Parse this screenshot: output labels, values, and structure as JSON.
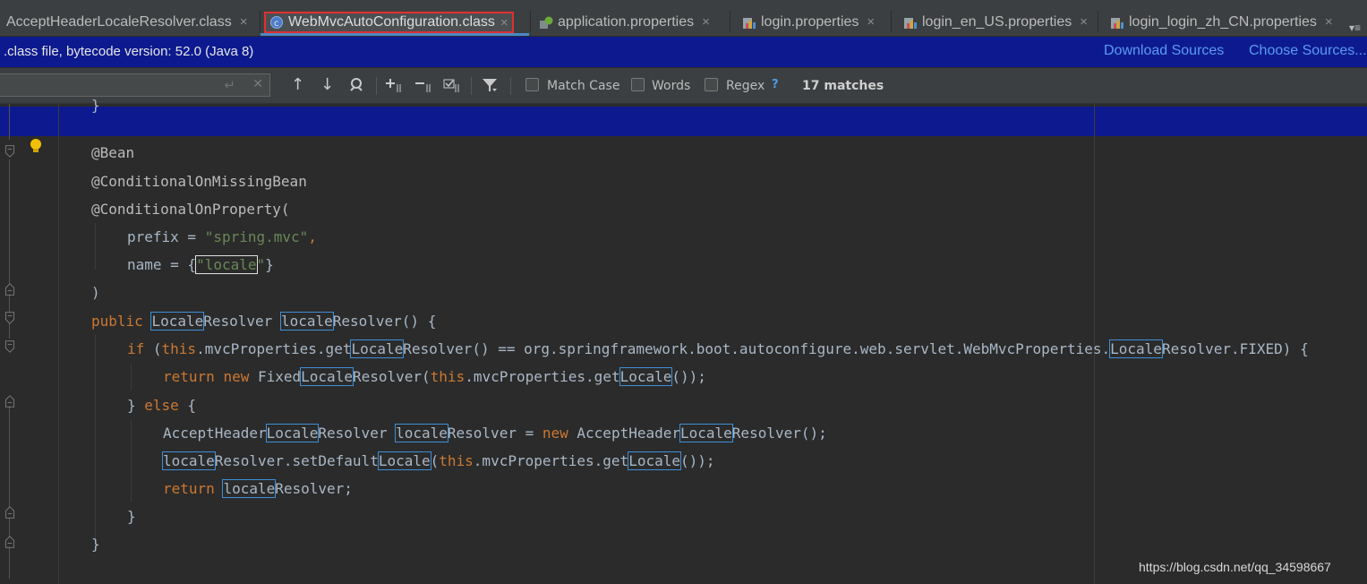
{
  "tabs": [
    {
      "label": "AcceptHeaderLocaleResolver.class",
      "icon": "class-file-icon"
    },
    {
      "label": "WebMvcAutoConfiguration.class",
      "icon": "class-file-icon",
      "active": true
    },
    {
      "label": "application.properties",
      "icon": "spring-properties-icon"
    },
    {
      "label": "login.properties",
      "icon": "properties-file-icon"
    },
    {
      "label": "login_en_US.properties",
      "icon": "properties-file-icon"
    },
    {
      "label": "login_login_zh_CN.properties",
      "icon": "properties-file-icon"
    }
  ],
  "tab_close_glyph": "×",
  "tab_overflow_glyph": "▾≡",
  "banner": {
    "message": ".class file, bytecode version: 52.0 (Java 8)",
    "download_sources": "Download Sources",
    "choose_sources": "Choose Sources..."
  },
  "findbar": {
    "search_value": "",
    "options": {
      "match_case": "Match Case",
      "words": "Words",
      "regex": "Regex"
    },
    "help": "?",
    "matches": "17 matches"
  },
  "code": {
    "l_bean": "@Bean",
    "l_missing": "@ConditionalOnMissingBean",
    "l_property": "@ConditionalOnProperty(",
    "prefix_a": "prefix = ",
    "prefix_str": "\"spring.mvc\"",
    "prefix_c": ",",
    "name_a": "name = {",
    "name_q1": "\"",
    "name_hit": "locale",
    "name_q2": "\"",
    "name_b": "}",
    "close_paren": ")",
    "kw_public": "public",
    "kw_if": "if",
    "kw_this": "this",
    "kw_return": "return",
    "kw_new": "new",
    "kw_else": "else",
    "hit_Locale": "Locale",
    "hit_locale": "locale",
    "m_resolver": "Resolver",
    "m_resolver_call": "Resolver() {",
    "if_open": " (",
    "if_mid1": ".mvcProperties.get",
    "if_mid2": "Resolver() == org.springframework.boot.autoconfigure.web.servlet.WebMvcProperties.",
    "if_end": "Resolver.FIXED) {",
    "fixed": "Fixed",
    "fixed_mid": "Resolver(",
    "fixed_mid2": ".mvcProperties.get",
    "fixed_end": "());",
    "else_a": "} ",
    "else_b": " {",
    "accept": "AcceptHeader",
    "accept_end": "Resolver();",
    "assign": "Resolver = ",
    "set_default": "Resolver.setDefault",
    "set_mid": "(",
    "set_mid2": ".mvcProperties.get",
    "set_end": "());",
    "ret_end": "Resolver;",
    "close_brace": "}",
    "top_fragment": "}"
  },
  "watermark": "https://blog.csdn.net/qq_34598667"
}
